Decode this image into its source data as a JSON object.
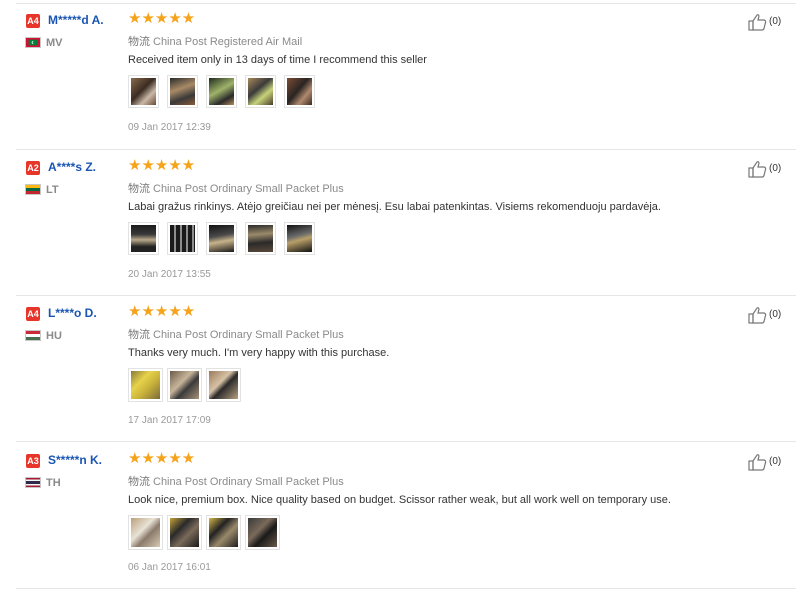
{
  "reviews": [
    {
      "level": "A4",
      "name": "M*****d A.",
      "country": "MV",
      "stars": "★★★★★",
      "shipping_cjk": "物流",
      "shipping": "China Post Registered Air Mail",
      "text": "Received item only in 13 days of time I recommend this seller",
      "photo_count": 5,
      "date": "09 Jan 2017 12:39",
      "likes": "(0)"
    },
    {
      "level": "A2",
      "name": "A****s Z.",
      "country": "LT",
      "stars": "★★★★★",
      "shipping_cjk": "物流",
      "shipping": "China Post Ordinary Small Packet Plus",
      "text": "Labai gražus rinkinys. Atėjo greičiau nei per mėnesį. Esu labai patenkintas. Visiems rekomenduoju pardavėja.",
      "photo_count": 5,
      "date": "20 Jan 2017 13:55",
      "likes": "(0)"
    },
    {
      "level": "A4",
      "name": "L****o D.",
      "country": "HU",
      "stars": "★★★★★",
      "shipping_cjk": "物流",
      "shipping": "China Post Ordinary Small Packet Plus",
      "text": "Thanks very much. I'm very happy with this purchase.",
      "photo_count": 3,
      "date": "17 Jan 2017 17:09",
      "likes": "(0)"
    },
    {
      "level": "A3",
      "name": "S*****n K.",
      "country": "TH",
      "stars": "★★★★★",
      "shipping_cjk": "物流",
      "shipping": "China Post Ordinary Small Packet Plus",
      "text": "Look nice, premium box. Nice quality based on budget. Scissor rather weak, but all work well on temporary use.",
      "photo_count": 4,
      "date": "06 Jan 2017 16:01",
      "likes": "(0)"
    }
  ],
  "colors": {
    "badge": "#e8352a",
    "username": "#1a55b4",
    "stars": "#f5a31a"
  },
  "icons": {
    "like": "thumbs-up-icon",
    "star": "star-icon"
  }
}
